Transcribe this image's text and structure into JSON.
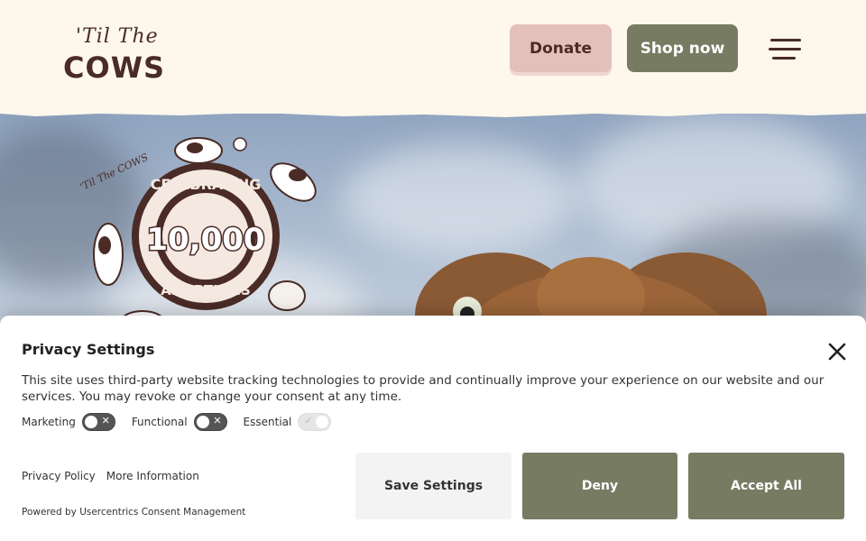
{
  "header": {
    "logo_script": "'Til The",
    "logo_main": "COWS",
    "donate_label": "Donate",
    "shop_label": "Shop now"
  },
  "hero": {
    "badge_brand": "'Til The COWS",
    "badge_top": "CELEBRATING",
    "badge_number": "10,000",
    "badge_bottom": "ADOPTIONS"
  },
  "privacy": {
    "title": "Privacy Settings",
    "description": "This site uses third-party website tracking technologies to provide and continually improve your experience on our website and our services. You may revoke or change your consent at any time.",
    "toggles": [
      {
        "label": "Marketing",
        "state": "off"
      },
      {
        "label": "Functional",
        "state": "off"
      },
      {
        "label": "Essential",
        "state": "on-disabled"
      }
    ],
    "links": [
      "Privacy Policy",
      "More Information"
    ],
    "powered_by": "Powered by Usercentrics Consent Management",
    "buttons": {
      "save": "Save Settings",
      "deny": "Deny",
      "accept": "Accept All"
    }
  },
  "colors": {
    "brand_brown": "#4a2b26",
    "donate_pink": "#e4c0bb",
    "olive": "#777b62",
    "cream": "#fdf7ec"
  },
  "icons": [
    "menu-icon",
    "close-icon",
    "x-icon",
    "check-icon"
  ]
}
